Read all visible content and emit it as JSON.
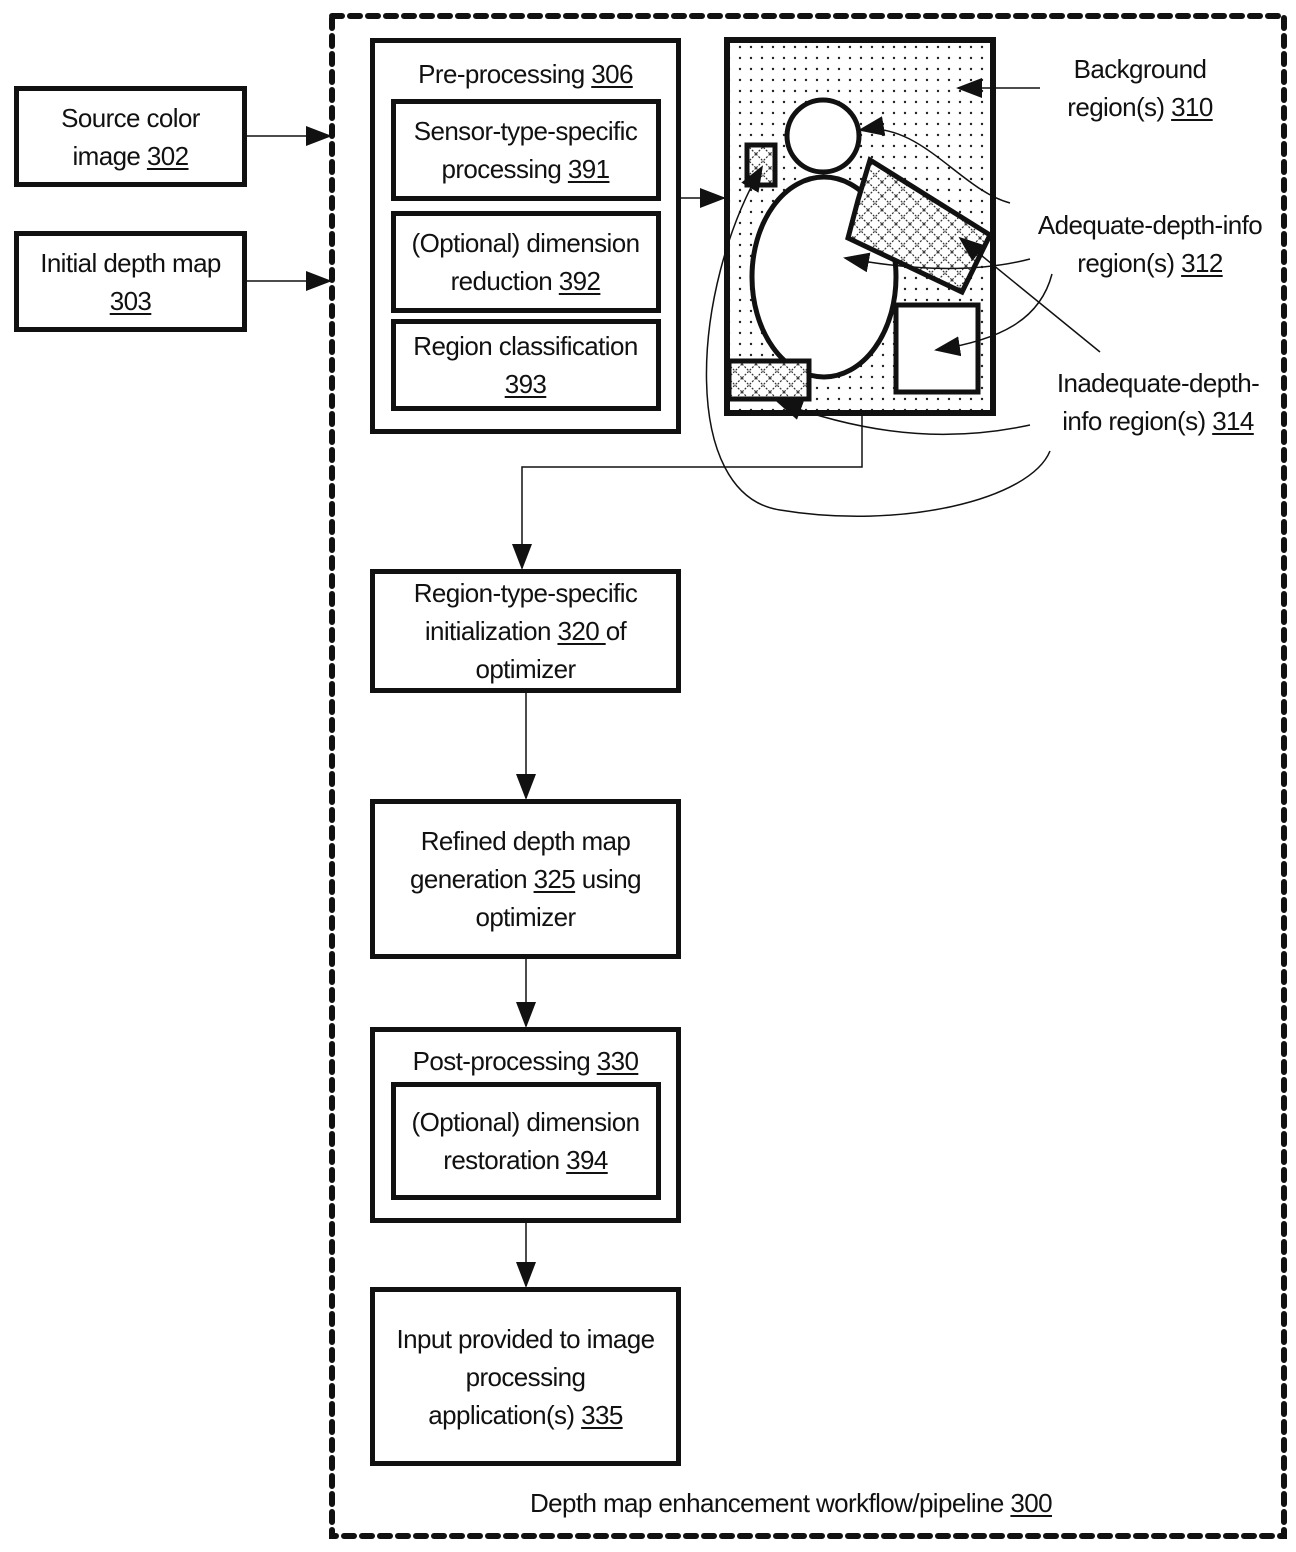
{
  "diagram": {
    "workflow_label": {
      "text": "Depth map enhancement workflow/pipeline ",
      "ref": "300"
    },
    "inputs": [
      {
        "lines": [
          {
            "text": "Source color"
          },
          {
            "text": "image ",
            "ref": "302"
          }
        ]
      },
      {
        "lines": [
          {
            "text": "Initial depth map"
          },
          {
            "text": "",
            "ref": "303"
          }
        ]
      }
    ],
    "preprocessing": {
      "title": {
        "text": "Pre-processing ",
        "ref": "306"
      },
      "steps": [
        {
          "lines": [
            {
              "text": "Sensor-type-specific"
            },
            {
              "text": "processing  ",
              "ref": "391"
            }
          ]
        },
        {
          "lines": [
            {
              "text": "(Optional) dimension"
            },
            {
              "text": "reduction  ",
              "ref": "392"
            }
          ]
        },
        {
          "lines": [
            {
              "text": "Region classification"
            },
            {
              "text": "",
              "ref": "393"
            }
          ]
        }
      ]
    },
    "region_labels": [
      {
        "lines": [
          {
            "text": "Background"
          },
          {
            "text": "region(s) ",
            "ref": "310"
          }
        ]
      },
      {
        "lines": [
          {
            "text": "Adequate-depth-info"
          },
          {
            "text": "region(s) ",
            "ref": "312"
          }
        ]
      },
      {
        "lines": [
          {
            "text": "Inadequate-depth-"
          },
          {
            "text": "info region(s) ",
            "ref": "314"
          }
        ]
      }
    ],
    "pipeline_steps": [
      {
        "lines": [
          {
            "text": "Region-type-specific"
          },
          {
            "text": "initialization  ",
            "ref": "320 ",
            "after": "of"
          },
          {
            "text": "optimizer"
          }
        ]
      },
      {
        "lines": [
          {
            "text": "Refined depth map"
          },
          {
            "text": "generation  ",
            "ref": "325",
            "after": " using"
          },
          {
            "text": "optimizer"
          }
        ]
      },
      {
        "title": {
          "text": "Post-processing  ",
          "ref": "330"
        },
        "sub": {
          "lines": [
            {
              "text": "(Optional) dimension"
            },
            {
              "text": "restoration  ",
              "ref": "394"
            }
          ]
        }
      },
      {
        "lines": [
          {
            "text": "Input provided to image"
          },
          {
            "text": "processing"
          },
          {
            "text": "application(s)  ",
            "ref": "335"
          }
        ]
      }
    ]
  },
  "colors": {
    "ink": "#111111",
    "background": "#ffffff"
  }
}
